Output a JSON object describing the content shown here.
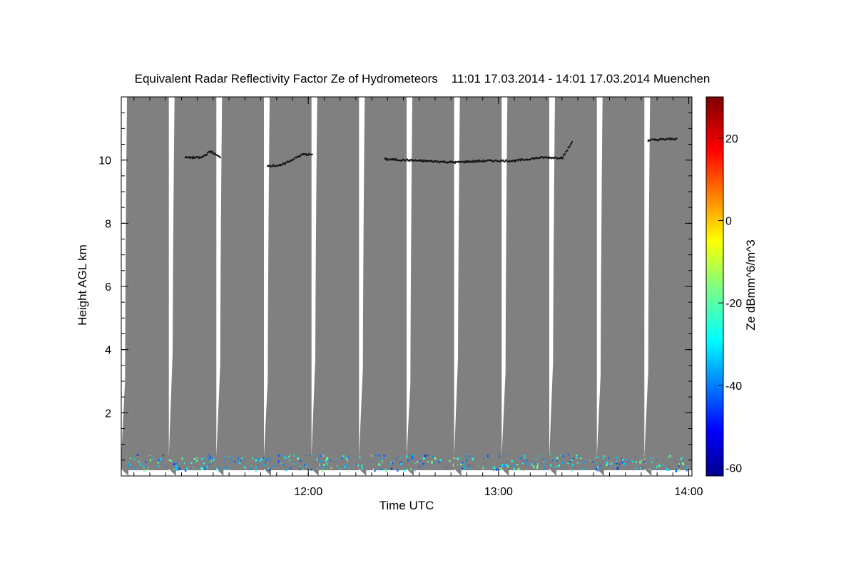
{
  "chart_data": {
    "type": "heatmap",
    "title": "Equivalent Radar Reflectivity Factor Ze of Hydrometeors    11:01 17.03.2014 - 14:01 17.03.2014 Muenchen",
    "xlabel": "Time UTC",
    "ylabel": "Height AGL km",
    "xlim": [
      "11:01",
      "14:01"
    ],
    "ylim": [
      0,
      12
    ],
    "xticks": [
      "12:00",
      "13:00",
      "14:00"
    ],
    "yticks": [
      2,
      4,
      6,
      8,
      10
    ],
    "colorbar": {
      "label": "Ze dBmm^6/m^3",
      "range": [
        -62,
        30
      ],
      "ticks": [
        -60,
        -40,
        -20,
        0,
        20
      ],
      "colormap": "jet"
    },
    "no_signal_color": "#808080",
    "scan_gap_end_heights_km": [
      3.0,
      3.9,
      3.5,
      3.0,
      3.7,
      3.4,
      2.9,
      3.7,
      3.3,
      3.6,
      3.2,
      3.3
    ],
    "cirrus_layer": [
      {
        "time": "11:21",
        "height_km": 10.1
      },
      {
        "time": "11:26",
        "height_km": 10.1
      },
      {
        "time": "11:29",
        "height_km": 10.3
      },
      {
        "time": "11:32",
        "height_km": 10.1
      },
      {
        "time": "11:47",
        "height_km": 9.85
      },
      {
        "time": "11:51",
        "height_km": 9.85
      },
      {
        "time": "11:58",
        "height_km": 10.2
      },
      {
        "time": "12:01",
        "height_km": 10.2
      },
      {
        "time": "12:24",
        "height_km": 10.05
      },
      {
        "time": "12:35",
        "height_km": 10.0
      },
      {
        "time": "12:46",
        "height_km": 9.95
      },
      {
        "time": "12:56",
        "height_km": 10.0
      },
      {
        "time": "13:05",
        "height_km": 10.0
      },
      {
        "time": "13:13",
        "height_km": 10.1
      },
      {
        "time": "13:20",
        "height_km": 10.1
      },
      {
        "time": "13:23",
        "height_km": 10.6
      },
      {
        "time": "13:47",
        "height_km": 10.65
      },
      {
        "time": "13:56",
        "height_km": 10.7
      }
    ],
    "near_surface_echo": {
      "height_range_km": [
        0.2,
        0.7
      ],
      "ze_range_dBZ": [
        -45,
        -15
      ]
    }
  }
}
